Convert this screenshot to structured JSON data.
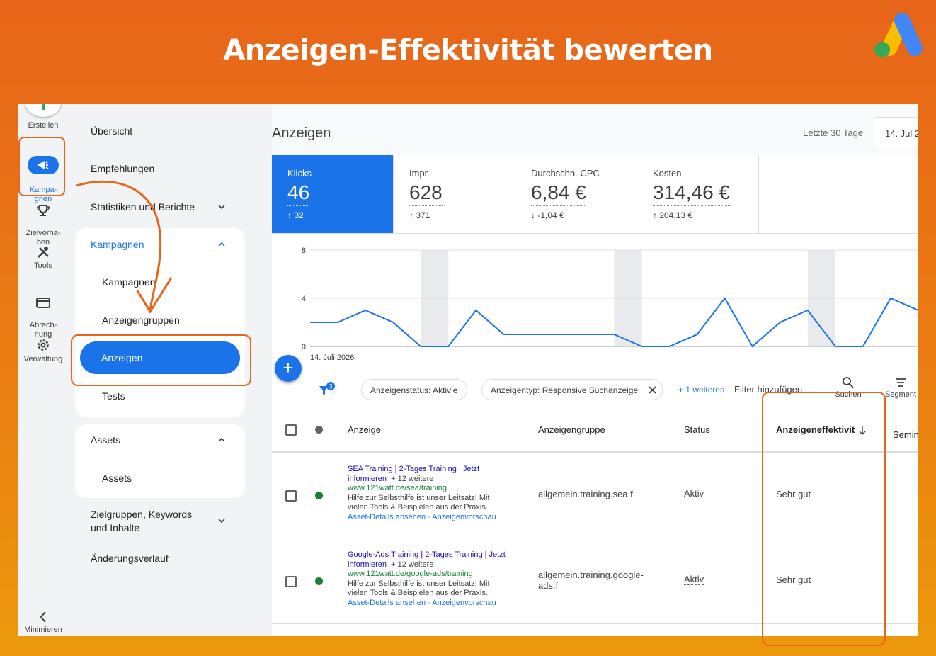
{
  "headline": "Anzeigen-Effektivität bewerten",
  "colors": {
    "accent_blue": "#1a73e8",
    "highlight_orange": "#e8651a",
    "status_green": "#188038"
  },
  "leftbar": {
    "create": "Erstellen",
    "campaigns": "Kampa-\ngnen",
    "goals": "Zielvorha-\nben",
    "tools": "Tools",
    "billing": "Abrech-\nnung",
    "admin": "Verwaltung",
    "minimize": "Minimieren"
  },
  "subnav": {
    "overview": "Übersicht",
    "recommendations": "Empfehlungen",
    "stats": "Statistiken und Berichte",
    "campaigns_section": "Kampagnen",
    "campaigns_item": "Kampagnen",
    "adgroups_item": "Anzeigengruppen",
    "ads_item": "Anzeigen",
    "tests_item": "Tests",
    "assets_section": "Assets",
    "assets_item": "Assets",
    "audiences": "Zielgruppen, Keywords\nund Inhalte",
    "changes": "Änderungsverlauf"
  },
  "main": {
    "title": "Anzeigen",
    "date_label": "Letzte 30 Tage",
    "date_value": "14. Jul 2"
  },
  "metrics": [
    {
      "label": "Klicks",
      "value": "46",
      "delta": "↑ 32"
    },
    {
      "label": "Impr.",
      "value": "628",
      "delta": "↑ 371"
    },
    {
      "label": "Durchschn. CPC",
      "value": "6,84 €",
      "delta": "↓ -1,04 €"
    },
    {
      "label": "Kosten",
      "value": "314,46 €",
      "delta": "↑ 204,13 €"
    }
  ],
  "chart_data": {
    "type": "line",
    "x_start_label": "14. Juli 2026",
    "yticks": [
      "0",
      "4",
      "8"
    ],
    "ylim": [
      0,
      8
    ],
    "values": [
      2,
      2,
      3,
      2,
      0,
      0,
      3,
      1,
      1,
      1,
      1,
      1,
      0,
      0,
      1,
      4,
      0,
      2,
      3,
      0,
      0,
      4,
      3
    ],
    "weekend_bands": [
      4,
      11,
      18
    ]
  },
  "filters": {
    "badge": "3",
    "chip1": "Anzeigenstatus: Aktivie",
    "chip2": "Anzeigentyp: Responsive Suchanzeige",
    "more": "+ 1 weiteres",
    "add": "Filter hinzufügen",
    "search": "Suchen",
    "segment": "Segment"
  },
  "table": {
    "headers": {
      "ad": "Anzeige",
      "adgroup": "Anzeigengruppe",
      "status": "Status",
      "effectiveness": "Anzeigeneffektivit",
      "next": "Semin"
    },
    "rows": [
      {
        "title": "SEA Training | 2-Tages Training | Jetzt informieren",
        "more": "+ 12 weitere",
        "url": "www.121watt.de/sea/training",
        "desc": "Hilfe zur Selbsthilfe ist unser Leitsatz! Mit vielen Tools & Beispielen aus der Praxis....",
        "links": "Asset-Details ansehen · Anzeigenvorschau",
        "adgroup": "allgemein.training.sea.f",
        "status": "Aktiv",
        "effectiveness": "Sehr gut"
      },
      {
        "title": "Google-Ads Training | 2-Tages Training | Jetzt informieren",
        "more": "+ 12 weitere",
        "url": "www.121watt.de/google-ads/training",
        "desc": "Hilfe zur Selbsthilfe ist unser Leitsatz! Mit vielen Tools & Beispielen aus der Praxis....",
        "links": "Asset-Details ansehen · Anzeigenvorschau",
        "adgroup": "allgemein.training.google-ads.f",
        "status": "Aktiv",
        "effectiveness": "Sehr gut"
      }
    ]
  }
}
